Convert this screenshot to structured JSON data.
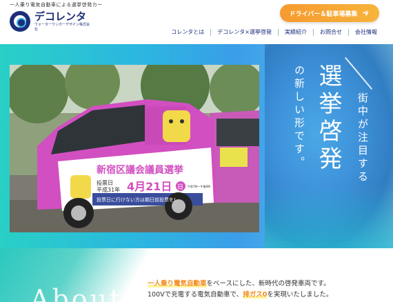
{
  "header": {
    "tagline": "一人乗り電気自動車による選挙啓発カー",
    "logo_name": "デコレンタ",
    "logo_sub": "ウォーターワンカーデザイン株式会社",
    "cta_label": "ドライバー＆駐車場募集"
  },
  "nav": {
    "items": [
      "コレンタとは",
      "デコレンタ×選挙啓発",
      "実績紹介",
      "お問合せ",
      "会社情報"
    ]
  },
  "hero": {
    "title": "選挙啓発",
    "sub1": "の新しい形です。",
    "sub2": "街中が注目する",
    "photo": {
      "sign_title": "新宿区議会議員選挙",
      "vote_day_label": "投票日",
      "year_label": "平成31年",
      "date_label": "4月21日",
      "weekday": "日",
      "hours": "午前7時〜午後8時",
      "bottom_banner": "投票日に行けない方は期日前投票を!"
    }
  },
  "about": {
    "title": "About",
    "line1_hl": "一人乗り電気自動車",
    "line1_rest": "をベースにした、新時代の啓発車両です。",
    "line2_pre": "100Vで充電する電気自動車で、",
    "line2_hl": "排ガス0",
    "line2_rest": "を実現いたしました。"
  },
  "colors": {
    "brand_navy": "#1c2e7a",
    "cta_orange": "#f79a2f",
    "hero_teal": "#29d0c6",
    "car_pink": "#d24fc1",
    "highlight_orange": "#f08a1c"
  }
}
